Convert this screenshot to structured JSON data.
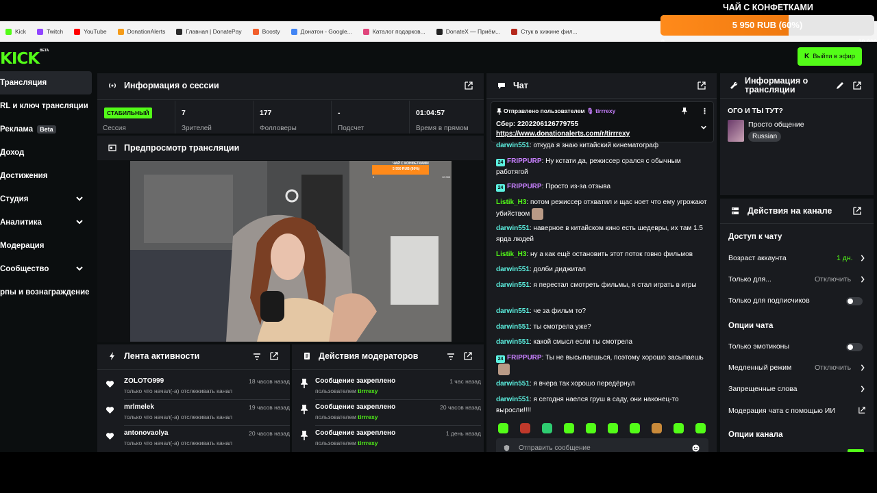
{
  "bookmarks": [
    {
      "label": "Kick",
      "color": "#53fc18"
    },
    {
      "label": "Twitch",
      "color": "#9146ff"
    },
    {
      "label": "YouTube",
      "color": "#ff0000"
    },
    {
      "label": "DonationAlerts",
      "color": "#f59c1a"
    },
    {
      "label": "Главная | DonatePay",
      "color": "#2b2b2b"
    },
    {
      "label": "Boosty",
      "color": "#f15f2c"
    },
    {
      "label": "Донатон - Google...",
      "color": "#4285f4"
    },
    {
      "label": "Каталог подарков...",
      "color": "#e0457b"
    },
    {
      "label": "DonateX — Приём...",
      "color": "#222222"
    },
    {
      "label": "Стук в хижине фил...",
      "color": "#b5291c"
    }
  ],
  "goal": {
    "title": "ЧАЙ С КОНФЕТКАМИ",
    "amount": "5 950 RUB (60%)",
    "progress": 0.6,
    "min": "0",
    "max": "10 000"
  },
  "header": {
    "logo": "KICK",
    "logo_badge": "BETA",
    "go_live": "Выйти в эфир"
  },
  "sidebar": {
    "items": [
      {
        "label": "Трансляция"
      },
      {
        "label": "RL и ключ трансляции"
      },
      {
        "label": "Реклама"
      },
      {
        "label": "Доход"
      },
      {
        "label": "Достижения"
      },
      {
        "label": "Студия"
      },
      {
        "label": "Аналитика"
      },
      {
        "label": "Модерация"
      },
      {
        "label": "Сообщество"
      },
      {
        "label": "рпы и вознаграждение"
      }
    ],
    "beta_badge": "Beta"
  },
  "session": {
    "title": "Информация о сессии",
    "status": "СТАБИЛЬНЫЙ",
    "status_label": "Сессия",
    "stats": [
      {
        "value": "7",
        "label": "Зрителей"
      },
      {
        "value": "177",
        "label": "Фолловеры"
      },
      {
        "value": "-",
        "label": "Подсчет"
      },
      {
        "value": "01:04:57",
        "label": "Время в прямом"
      }
    ]
  },
  "preview": {
    "title": "Предпросмотр трансляции",
    "overlay_title": "ЧАЙ С КОНФЕТКАМИ",
    "overlay_amount": "5 950 RUB (60%)",
    "overlay_min": "0",
    "overlay_max": "10 000"
  },
  "activity": {
    "title": "Лента активности",
    "items": [
      {
        "name": "ZOLOTO999",
        "time": "18 часов назад",
        "sub": "только что начал(-а) отслеживать канал"
      },
      {
        "name": "mrlmelek",
        "time": "19 часов назад",
        "sub": "только что начал(-а) отслеживать канал"
      },
      {
        "name": "antonovaolya",
        "time": "20 часов назад",
        "sub": "только что начал(-а) отслеживать канал"
      }
    ]
  },
  "mod_actions": {
    "title": "Действия модераторов",
    "items": [
      {
        "name": "Сообщение закреплено",
        "time": "1 час назад",
        "by": "пользователем",
        "user": "tirrrexy"
      },
      {
        "name": "Сообщение закреплено",
        "time": "20 часов назад",
        "by": "пользователем",
        "user": "tirrrexy"
      },
      {
        "name": "Сообщение закреплено",
        "time": "1 день назад",
        "by": "пользователем",
        "user": "tirrrexy"
      }
    ]
  },
  "chat": {
    "title": "Чат",
    "pinned": {
      "header": "Отправлено пользователем",
      "user": "tirrrexy",
      "line1": "Сбер: 2202206126779755",
      "link": "https://www.donationalerts.com/r/tirrrexy"
    },
    "messages": [
      {
        "user": "darwin551",
        "color": "cyan",
        "badge": "",
        "text": ": откуда я знаю китайский кинематограф"
      },
      {
        "user": "FRIPPURP",
        "color": "purple",
        "badge": "24",
        "text": ": Ну кстати да, режиссер срался с обычным работягой"
      },
      {
        "user": "FRIPPURP",
        "color": "purple",
        "badge": "24",
        "text": ": Просто из-за отзыва"
      },
      {
        "user": "Listik_H3",
        "color": "green",
        "badge": "",
        "text": ": потом режиссер отхватил и щас ноет что ему угрожают убийством"
      },
      {
        "user": "darwin551",
        "color": "cyan",
        "badge": "",
        "text": ": наверное в китайском кино есть шедевры, их там 1.5 ярда людей"
      },
      {
        "user": "Listik_H3",
        "color": "green",
        "badge": "",
        "text": ": ну а как ещё остановить этот поток говно фильмов"
      },
      {
        "user": "darwin551",
        "color": "cyan",
        "badge": "",
        "text": ": долби диджитал"
      },
      {
        "user": "darwin551",
        "color": "cyan",
        "badge": "",
        "text": ": я перестал смотреть фильмы, я стал играть в игры"
      },
      {
        "user": "darwin551",
        "color": "cyan",
        "badge": "",
        "text": ": че за фильм то?"
      },
      {
        "user": "darwin551",
        "color": "cyan",
        "badge": "",
        "text": ": ты смотрела уже?"
      },
      {
        "user": "darwin551",
        "color": "cyan",
        "badge": "",
        "text": ": какой смысл если ты смотрела"
      },
      {
        "user": "FRIPPURP",
        "color": "purple",
        "badge": "24",
        "text": ": Ты не высыпаешься, поэтому хорошо засыпаешь"
      },
      {
        "user": "darwin551",
        "color": "cyan",
        "badge": "",
        "text": ": я вчера так хорошо передёрнул"
      },
      {
        "user": "darwin551",
        "color": "cyan",
        "badge": "",
        "text": ": я сегодня наелся груш в саду, они наконец-то выросли!!!!"
      }
    ],
    "input_placeholder": "Отправить сообщение"
  },
  "stream_info": {
    "title": "Информация о трансляции",
    "stream_title": "ОГО И ТЫ ТУТ?",
    "category": "Просто общение",
    "language": "Russian"
  },
  "channel_actions": {
    "title": "Действия на канале",
    "chat_access_title": "Доступ к чату",
    "account_age_label": "Возраст аккаунта",
    "account_age_value": "1 дн.",
    "only_for_label": "Только для...",
    "only_for_value": "Отключить",
    "subs_only_label": "Только для подписчиков",
    "chat_options_title": "Опции чата",
    "emotes_only_label": "Только эмотиконы",
    "slow_mode_label": "Медленный режим",
    "slow_mode_value": "Отключить",
    "banned_words_label": "Запрещенные слова",
    "ai_mod_label": "Модерация чата с помощью ИИ",
    "channel_options_title": "Опции канала"
  },
  "colors": {
    "accent": "#53fc18",
    "panel": "#191b1f",
    "bg": "#0b0e0f"
  }
}
